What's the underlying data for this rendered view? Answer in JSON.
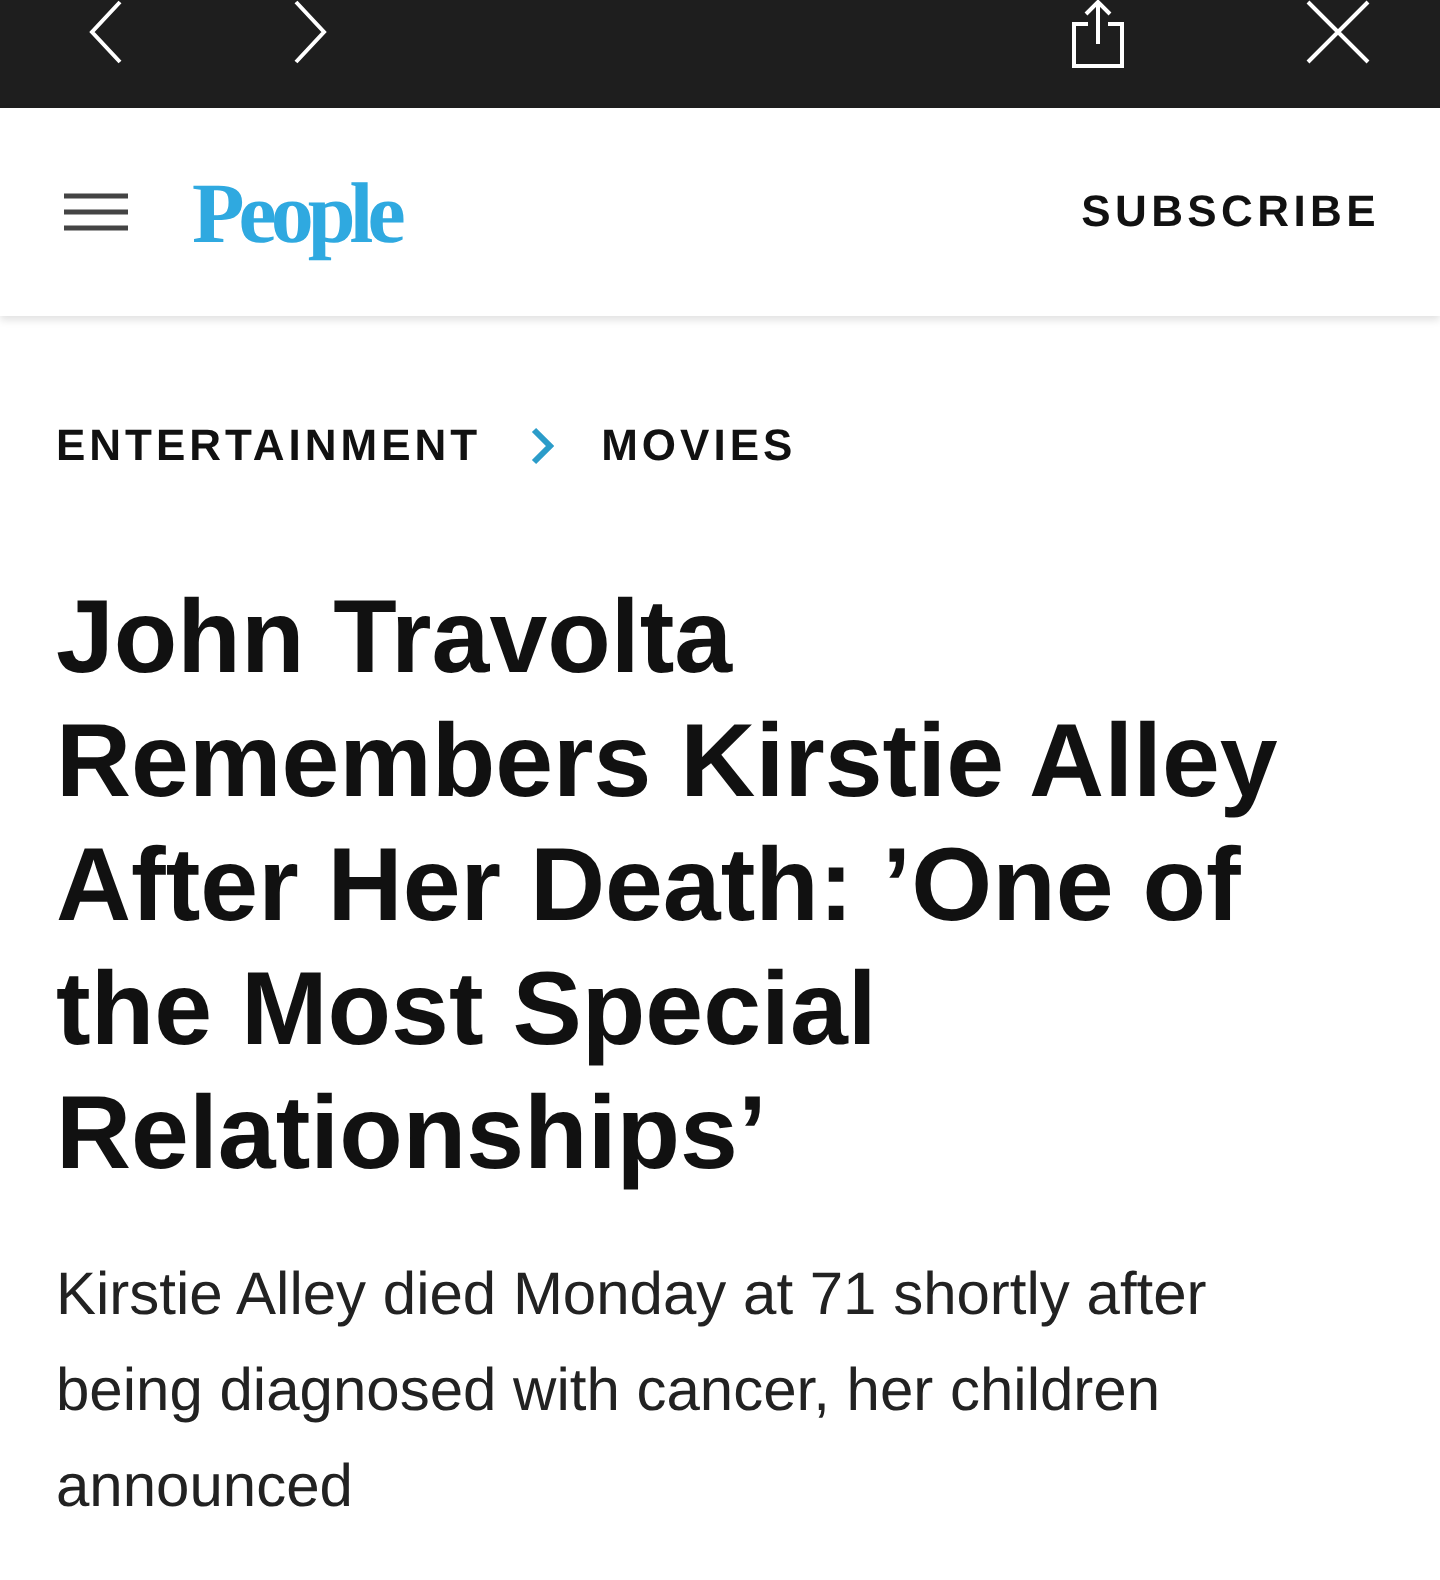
{
  "header": {
    "brand": "People",
    "action": "SUBSCRIBE"
  },
  "breadcrumb": [
    {
      "label": "ENTERTAINMENT"
    },
    {
      "label": "MOVIES"
    }
  ],
  "article": {
    "headline": "John Travolta Remembers Kirstie Alley After Her Death: ’One of the Most Special Relationships’",
    "dek": "Kirstie Alley died Monday at 71 shortly after being diagnosed with cancer, her children announced"
  }
}
